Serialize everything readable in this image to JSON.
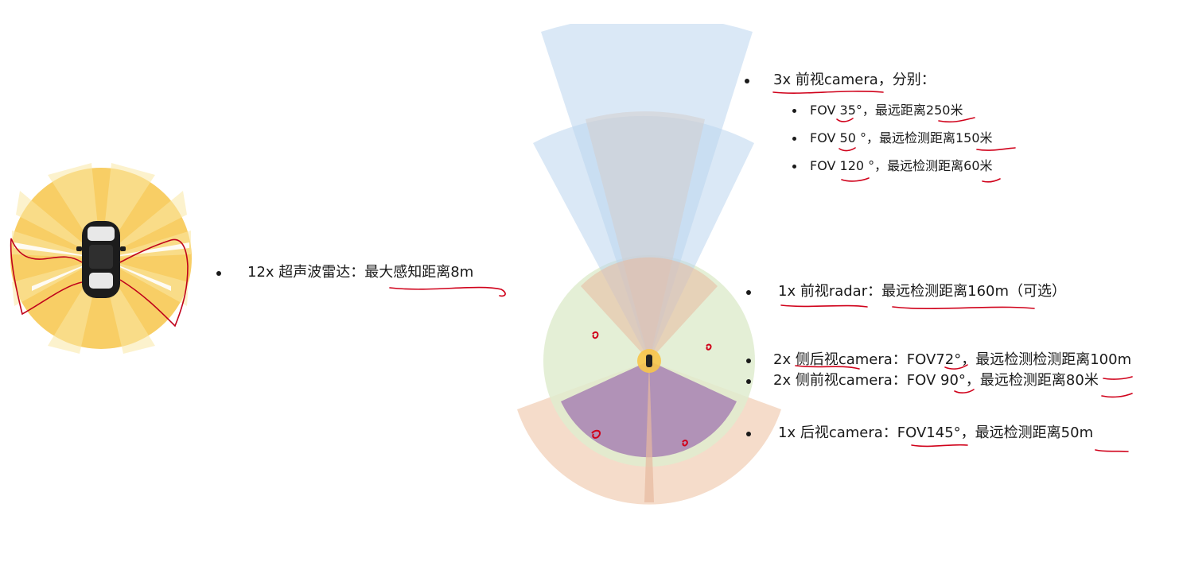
{
  "ultrasonic": {
    "label": "12x 超声波雷达：最大感知距离8m"
  },
  "front_cameras": {
    "heading": "3x 前视camera，分别：",
    "items": [
      {
        "label": "FOV 35°，最远距离250米"
      },
      {
        "label": "FOV 50 °，最远检测距离150米"
      },
      {
        "label": "FOV 120 °，最远检测距离60米"
      }
    ]
  },
  "radar": {
    "label": "1x 前视radar：最远检测距离160m（可选）"
  },
  "side_rear_cameras": {
    "label": "2x 侧后视camera：FOV72°，最远检测检测距离100m"
  },
  "side_front_cameras": {
    "label": "2x 侧前视camera：FOV 90°，最远检测距离80米"
  },
  "rear_camera": {
    "label": "1x 后视camera：FOV145°，最远检测距离50m"
  },
  "colors": {
    "ultrasonic": "#f5b82e",
    "camera_blue": "#bcd6ef",
    "radar_peach": "#efc4a6",
    "side_green": "#dfeccf",
    "rear_purple": "#a883b3",
    "annotation_red": "#d0021b"
  }
}
